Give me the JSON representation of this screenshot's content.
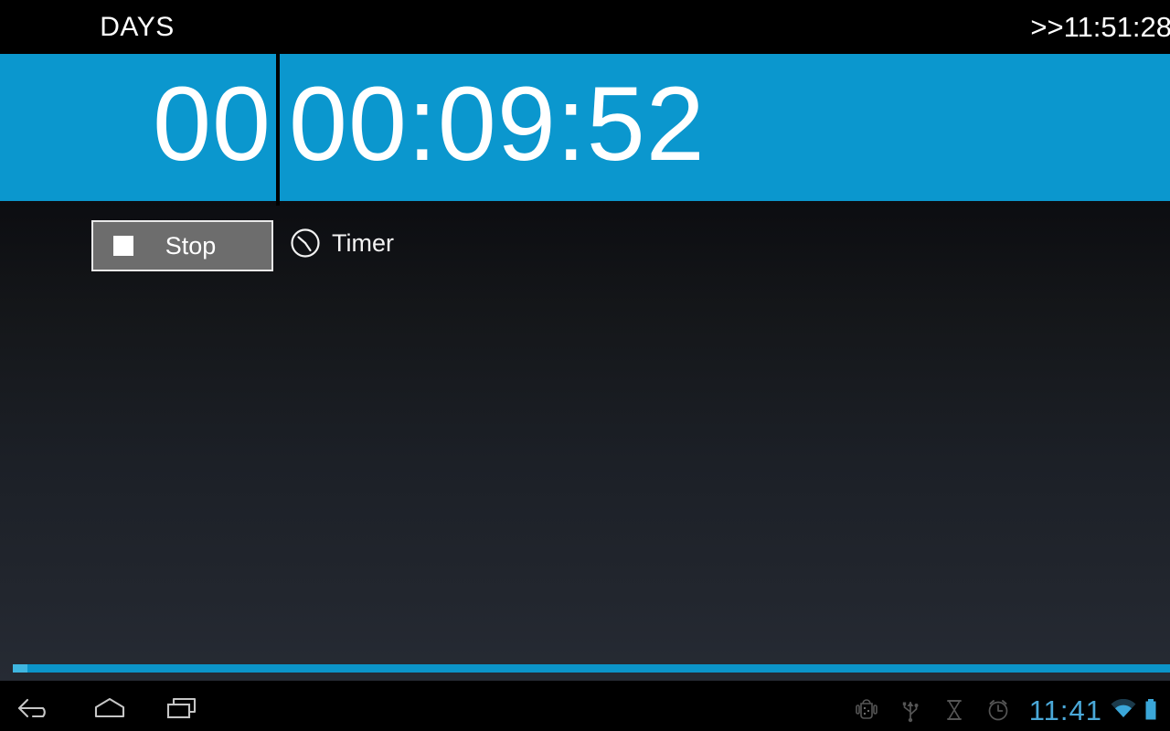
{
  "app": {
    "header": {
      "days_caption": "DAYS",
      "target_time": ">>11:51:28"
    },
    "timer": {
      "days_value": "00",
      "time_value": "00:09:52",
      "accent_color": "#0b97ce",
      "digit_color": "#ffffff"
    },
    "controls": {
      "stop_label": "Stop",
      "stop_icon": "stop-square-icon",
      "mode_label": "Timer",
      "mode_icon": "clock-icon"
    },
    "progress": {
      "fill_color": "#0b94c9",
      "head_color": "#3fb6e0"
    }
  },
  "system": {
    "nav": {
      "back_label": "Back",
      "home_label": "Home",
      "recents_label": "Recent apps"
    },
    "status": {
      "icons": [
        "android-debug-icon",
        "usb-icon",
        "hourglass-icon",
        "alarm-clock-icon"
      ],
      "clock": "11:41",
      "wifi_icon": "wifi-icon",
      "battery_icon": "battery-icon",
      "accent_color": "#4aa8d8"
    }
  }
}
